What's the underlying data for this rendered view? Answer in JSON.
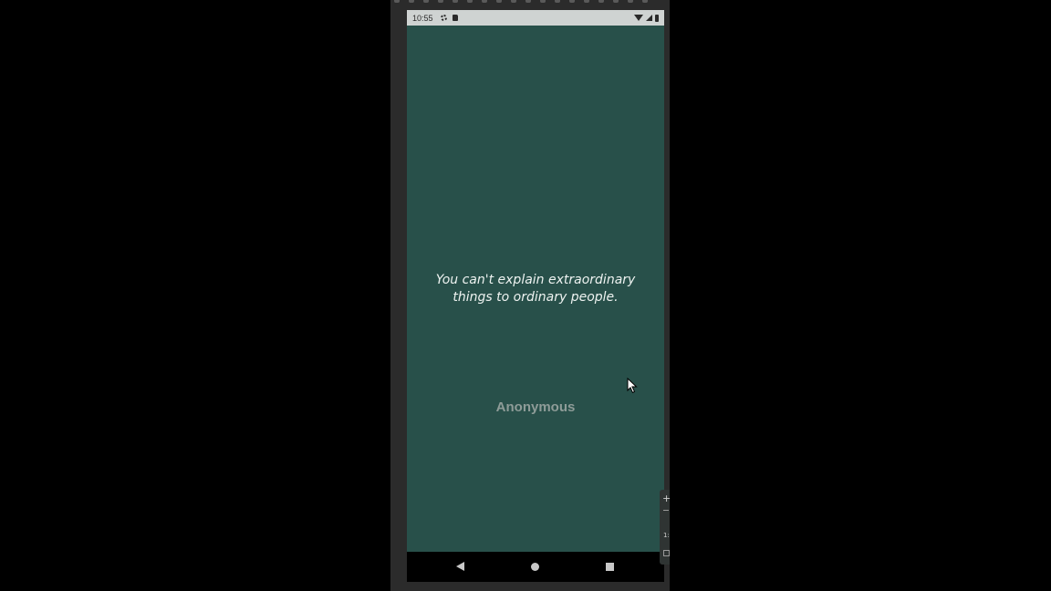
{
  "status_bar": {
    "time": "10:55",
    "icons": [
      "settings-gear-icon",
      "sd-card-icon",
      "wifi-icon",
      "signal-icon",
      "battery-icon"
    ]
  },
  "quote": {
    "text": "You can't explain extraordinary things to ordinary people.",
    "author": "Anonymous"
  },
  "nav_bar": {
    "buttons": [
      "back-icon",
      "home-icon",
      "recents-icon"
    ]
  },
  "side_tools": {
    "zoom_in_label": "+",
    "ratio_label": "1:"
  },
  "colors": {
    "screen_background": "#28504a",
    "quote_text": "#eef3f1",
    "author_text": "#8e9c98",
    "status_bar": "#cfd3d2",
    "nav_bar": "#000000"
  }
}
